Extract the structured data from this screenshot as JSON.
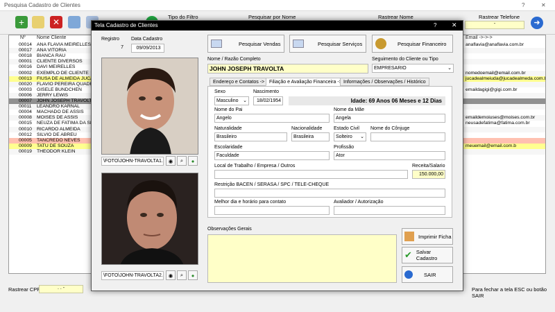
{
  "bg": {
    "title": "Pesquisa Cadastro de Clientes",
    "tipo_filtro": "Tipo do Filtro",
    "pesquisar_por_nome": "Pesquisar por Nome",
    "rastrear_nome": "Rastrear Nome",
    "rastrear_telefone": "Rastrear Telefone",
    "phone_value": "-",
    "col_n": "Nº",
    "col_nome": "Nome Cliente",
    "col_email": "Email ->->->",
    "rastrear_cpf": "Rastrear CPF",
    "cpf_value": ". . -",
    "fechar_hint": "Para fechar a tela ESC ou botão SAIR",
    "rows": [
      {
        "num": "00014",
        "name": "ANA FLAVIA MEIRELLES",
        "email": "anaflavia@anaflavia.com.br"
      },
      {
        "num": "00017",
        "name": "ANA VITÓRIA",
        "email": ""
      },
      {
        "num": "00018",
        "name": "BIANCA RAU",
        "email": ""
      },
      {
        "num": "00001",
        "name": "CLIENTE DIVERSOS",
        "email": ""
      },
      {
        "num": "00016",
        "name": "DAVI MEIRELLES",
        "email": ""
      },
      {
        "num": "00002",
        "name": "EXEMPLO DE CLIENTE",
        "email": "nomedoemail@email.com.br"
      },
      {
        "num": "00013",
        "name": "FIUSA DE ALMEIDA JUCA C",
        "email": "jucadealmeiuda@jucadealmeda.com.br"
      },
      {
        "num": "00020",
        "name": "FLAVIO PEREIRA QUADRAD",
        "email": ""
      },
      {
        "num": "00003",
        "name": "GISELE BUNDCHEN",
        "email": "emaildagigi@gigi.com.br"
      },
      {
        "num": "00006",
        "name": "JERRY LEWIS",
        "email": ""
      },
      {
        "num": "00007",
        "name": "JOHN JOSEPH TRAVOLTA",
        "email": ""
      },
      {
        "num": "00011",
        "name": "LEANDRO KARNAL",
        "email": ""
      },
      {
        "num": "00004",
        "name": "MACHADO DE ASSIS",
        "email": ""
      },
      {
        "num": "00008",
        "name": "MOISES DE ASSIS",
        "email": "emaildemoiuses@moises.com.br"
      },
      {
        "num": "00015",
        "name": "NEUZA DE FATIMA DA SILV",
        "email": "neusadefatima@fatima.com.br"
      },
      {
        "num": "00010",
        "name": "RICARDO ALMEIDA",
        "email": ""
      },
      {
        "num": "00012",
        "name": "SILVIO DE ABREU",
        "email": ""
      },
      {
        "num": "00005",
        "name": "TANCREDO NEVES",
        "email": ""
      },
      {
        "num": "00009",
        "name": "TATU DE SOUZA",
        "email": "meuemail@email.com.b"
      },
      {
        "num": "00019",
        "name": "THEODOR KLEIN",
        "email": ""
      }
    ]
  },
  "modal": {
    "title": "Tela Cadastro de Clientes",
    "help": "?",
    "close": "✕",
    "registro_label": "Registro",
    "registro_value": "7",
    "data_label": "Data Cadastro",
    "data_value": "09/09/2013",
    "btn_vendas": "Pesquisar Vendas",
    "btn_servicos": "Pesquisar Serviços",
    "btn_financeiro": "Pesquisar Financeiro",
    "nome_label": "Nome / Razão Completo",
    "nome_value": "JOHN JOSEPH TRAVOLTA",
    "seguimento_label": "Seguimento do Cliente ou Tipo",
    "seguimento_value": "EMPRESARIO",
    "tabs": [
      "Endereço e Contatos ->",
      "Filiação e Avaliação Financeira ->",
      "Informações / Observações / Histórico"
    ],
    "sexo_label": "Sexo",
    "sexo_value": "Masculino",
    "nasc_label": "Nascimento",
    "nasc_value": "18/02/1954",
    "idade": "Idade: 69 Anos 06 Meses e 12 Dias",
    "pai_label": "Nome do Pai",
    "pai_value": "Angelo",
    "mae_label": "Nome da Mãe",
    "mae_value": "Angela",
    "natural_label": "Naturalidade",
    "natural_value": "Brasileiro",
    "nacion_label": "Nacionalidade",
    "nacion_value": "Brasileira",
    "civil_label": "Estado Civil",
    "civil_value": "Solteiro",
    "conjuge_label": "Nome do Cônjuge",
    "escol_label": "Escolaridade",
    "escol_value": "Faculdade",
    "prof_label": "Profissão",
    "prof_value": "Ator",
    "trabalho_label": "Local de Trabalho / Empresa / Outros",
    "receita_label": "Receita/Salario",
    "receita_value": "150.000,00",
    "restricao_label": "Restrição BACEN / SERASA / SPC / TELE-CHEQUE",
    "contato_label": "Melhor dia e horário para contato",
    "avaliador_label": "Avaliador / Autorização",
    "obs_label": "Observações Gerais",
    "photo1_path": "\\FOTO\\JOHN-TRAVOLTA1.",
    "photo2_path": "\\FOTO\\JOHN-TRAVOLTA2.",
    "btn_imprimir": "Imprimir Ficha",
    "btn_salvar": "Salvar Cadastro",
    "btn_sair": "SAIR"
  }
}
